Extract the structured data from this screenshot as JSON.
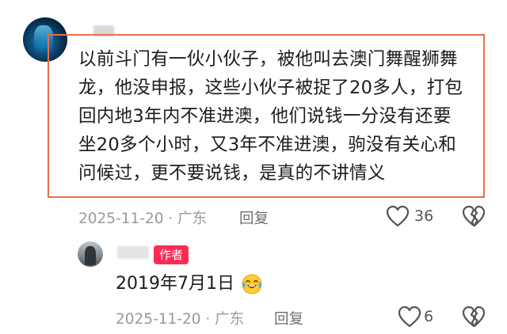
{
  "comment": {
    "text": "以前斗门有一伙小伙子，被他叫去澳门舞醒狮舞龙，他没申报，这些小伙子被捉了20多人，打包回内地3年内不准进澳，他们说钱一分没有还要坐20多个小时，又3年不准进澳，驹没有关心和问候过，更不要说钱，是真的不讲情义",
    "lines": [
      "以前斗门有一伙小伙子，被他叫去澳门舞醒狮舞",
      "龙，他没申报，这些小伙子被捉了20多人，打包",
      "回内地3年内不准进澳，他们说钱一分没有还要",
      "坐20多个小时，又3年不准进澳，驹没有关心和",
      "问候过，更不要说钱，是真的不讲情义"
    ],
    "meta": "2025-11-20 · 广东",
    "reply_label": "回复",
    "like_count": "36",
    "highlight_color": "#e4704e"
  },
  "reply": {
    "badge": "作者",
    "badge_color": "#fe2c55",
    "text": "2019年7月1日",
    "emoji": "face-with-tears-of-joy",
    "meta": "2025-11-20 · 广东",
    "reply_label": "回复",
    "like_count": "6"
  }
}
